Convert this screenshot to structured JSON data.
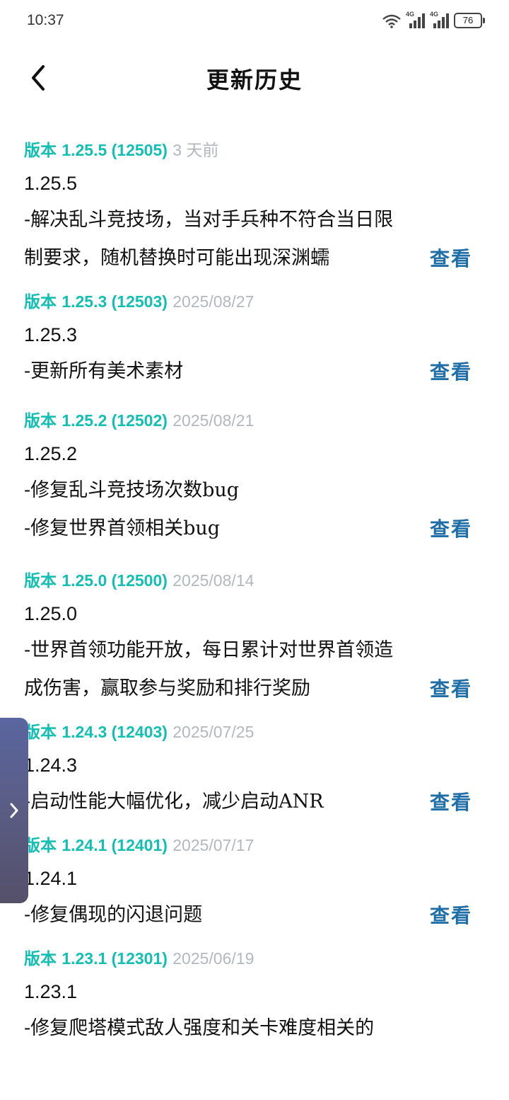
{
  "status_bar": {
    "time": "10:37",
    "network_1": "4G",
    "network_2": "4G",
    "battery": "76"
  },
  "header": {
    "title": "更新历史",
    "back_icon": "chevron-left-icon"
  },
  "view_label": "查看",
  "side_tab_icon": "chevron-right-icon",
  "colors": {
    "accent_teal": "#13bfb2",
    "date_gray": "#b3b8bd",
    "link_blue": "#1f6ea7"
  },
  "entries": [
    {
      "label": "版本",
      "version": "1.25.5 (12505)",
      "date": "3 天前",
      "title": "1.25.5",
      "notes": [
        "-解决乱斗竞技场，当对手兵种不符合当日限",
        "制要求，随机替换时可能出现深渊蠕"
      ]
    },
    {
      "label": "版本",
      "version": "1.25.3 (12503)",
      "date": "2025/08/27",
      "title": "1.25.3",
      "notes": [
        "-更新所有美术素材"
      ]
    },
    {
      "label": "版本",
      "version": "1.25.2 (12502)",
      "date": "2025/08/21",
      "title": "1.25.2",
      "notes": [
        "-修复乱斗竞技场次数bug",
        "-修复世界首领相关bug"
      ]
    },
    {
      "label": "版本",
      "version": "1.25.0 (12500)",
      "date": "2025/08/14",
      "title": "1.25.0",
      "notes": [
        "-世界首领功能开放，每日累计对世界首领造",
        "成伤害，赢取参与奖励和排行奖励"
      ]
    },
    {
      "label": "版本",
      "version": "1.24.3 (12403)",
      "date": "2025/07/25",
      "title": "1.24.3",
      "notes": [
        "-启动性能大幅优化，减少启动ANR"
      ]
    },
    {
      "label": "版本",
      "version": "1.24.1 (12401)",
      "date": "2025/07/17",
      "title": "1.24.1",
      "notes": [
        "-修复偶现的闪退问题"
      ]
    },
    {
      "label": "版本",
      "version": "1.23.1 (12301)",
      "date": "2025/06/19",
      "title": "1.23.1",
      "notes": [
        "-修复爬塔模式敌人强度和关卡难度相关的"
      ]
    }
  ]
}
